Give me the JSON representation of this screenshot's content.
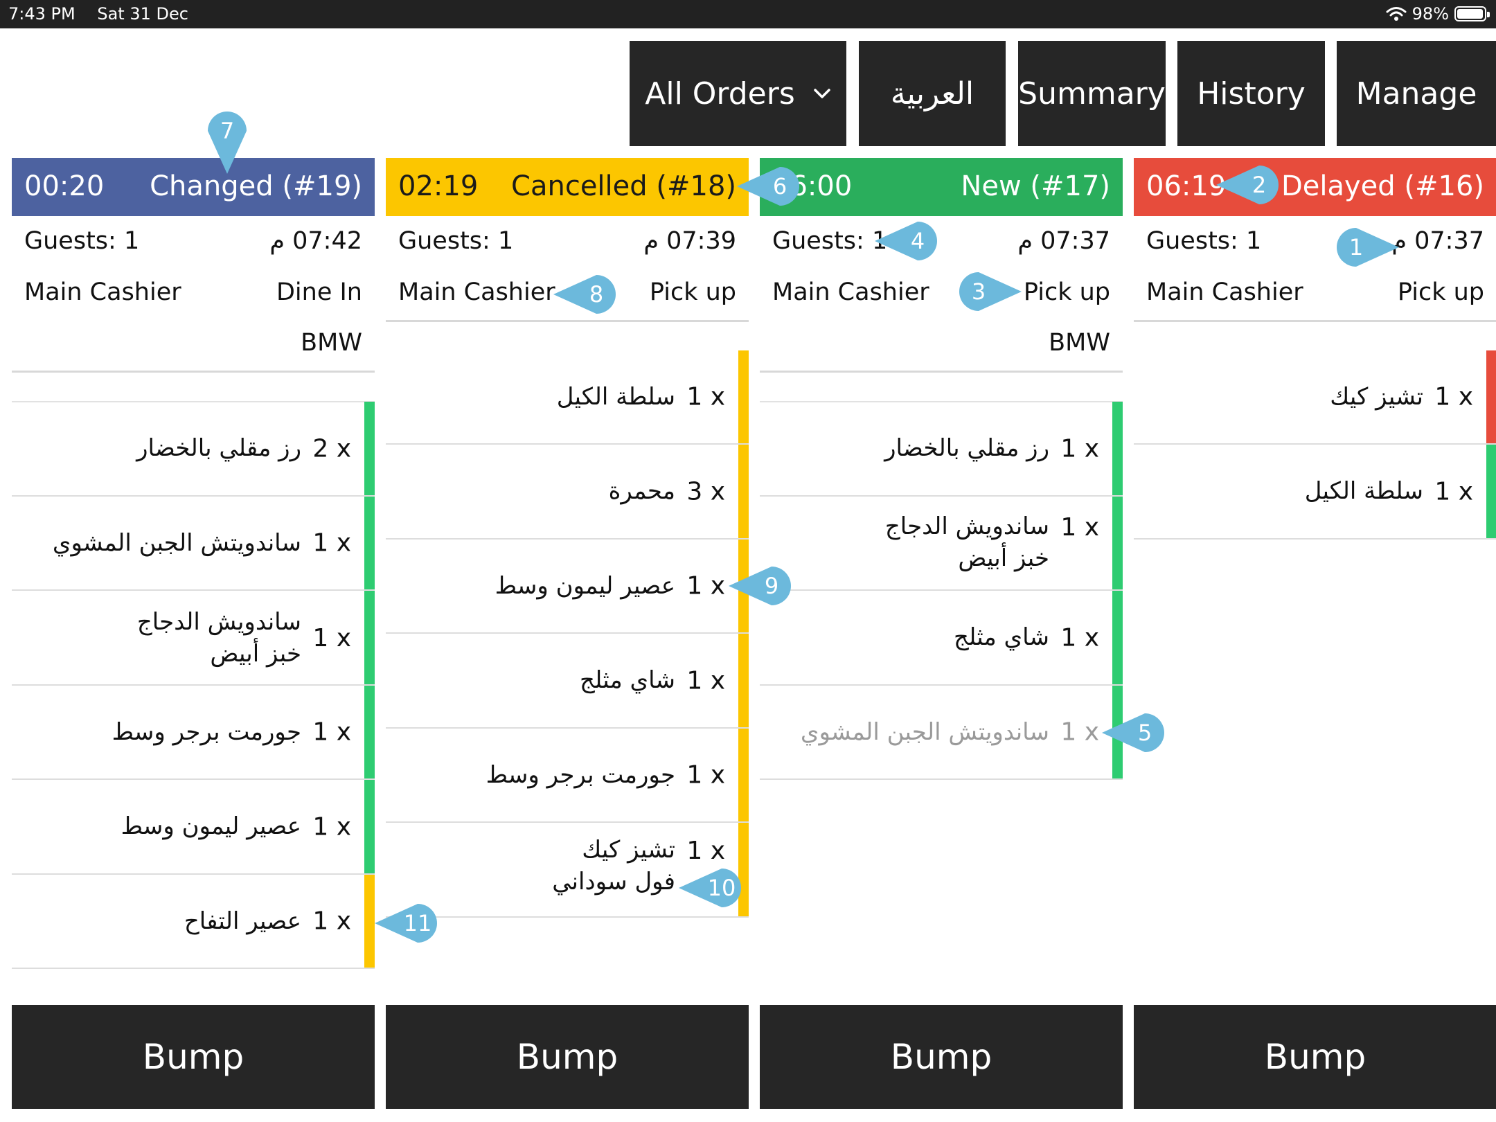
{
  "status_bar": {
    "time": "7:43 PM",
    "date": "Sat 31 Dec",
    "battery": "98%",
    "battery_level": 0.98
  },
  "toolbar": {
    "all_orders": "All Orders",
    "arabic": "العربية",
    "summary": "Summary",
    "history": "History",
    "manage": "Manage"
  },
  "colors": {
    "changed": "#4d62a0",
    "cancelled": "#fcc600",
    "new": "#2aae5c",
    "delayed": "#e74c3c",
    "bar_green": "#2ecc71",
    "bar_yellow": "#fcc600",
    "bar_red": "#e74c3c",
    "callout": "#6cb9dc",
    "dark": "#262626"
  },
  "orders": [
    {
      "timer": "00:20",
      "status": "Changed (#19)",
      "guests": "Guests: 1",
      "time": "07:42 م",
      "cashier": "Main Cashier",
      "type": "Dine In",
      "car": "BMW",
      "items": [
        {
          "qty": "2 x",
          "name": [
            "رز مقلي بالخضار"
          ]
        },
        {
          "qty": "1 x",
          "name": [
            "ساندويتش الجبن المشوي"
          ]
        },
        {
          "qty": "1 x",
          "name": [
            "ساندويش الدجاج",
            "خبز أبيض"
          ]
        },
        {
          "qty": "1 x",
          "name": [
            "جورمت برجر وسط"
          ]
        },
        {
          "qty": "1 x",
          "name": [
            "عصير ليمون وسط"
          ]
        },
        {
          "qty": "1 x",
          "name": [
            "عصير التفاح"
          ]
        }
      ],
      "bump": "Bump"
    },
    {
      "timer": "02:19",
      "status": "Cancelled (#18)",
      "guests": "Guests: 1",
      "time": "07:39 م",
      "cashier": "Main Cashier",
      "type": "Pick up",
      "car": "",
      "items": [
        {
          "qty": "1 x",
          "name": [
            "سلطة الكيل"
          ]
        },
        {
          "qty": "3 x",
          "name": [
            "محمرة"
          ]
        },
        {
          "qty": "1 x",
          "name": [
            "عصير ليمون وسط"
          ]
        },
        {
          "qty": "1 x",
          "name": [
            "شاي مثلج"
          ]
        },
        {
          "qty": "1 x",
          "name": [
            "جورمت برجر وسط"
          ]
        },
        {
          "qty": "1 x",
          "name": [
            "تشيز كيك",
            "فول سوداني"
          ]
        }
      ],
      "bump": "Bump"
    },
    {
      "timer": "06:00",
      "status": "New (#17)",
      "guests": "Guests: 1",
      "time": "07:37 م",
      "cashier": "Main Cashier",
      "type": "Pick up",
      "car": "BMW",
      "items": [
        {
          "qty": "1 x",
          "name": [
            "رز مقلي بالخضار"
          ]
        },
        {
          "qty": "1 x",
          "name": [
            "ساندويش الدجاج",
            "خبز أبيض"
          ]
        },
        {
          "qty": "1 x",
          "name": [
            "شاي مثلج"
          ]
        },
        {
          "qty": "1 x",
          "name": [
            "ساندويتش الجبن المشوي"
          ]
        }
      ],
      "bump": "Bump"
    },
    {
      "timer": "06:19",
      "status": "Delayed (#16)",
      "guests": "Guests: 1",
      "time": "07:37 م",
      "cashier": "Main Cashier",
      "type": "Pick up",
      "car": "",
      "items": [
        {
          "qty": "1 x",
          "name": [
            "تشيز كيك"
          ]
        },
        {
          "qty": "1 x",
          "name": [
            "سلطة الكيل"
          ]
        }
      ],
      "bump": "Bump"
    }
  ],
  "callouts": [
    "1",
    "2",
    "3",
    "4",
    "5",
    "6",
    "7",
    "8",
    "9",
    "10",
    "11"
  ]
}
